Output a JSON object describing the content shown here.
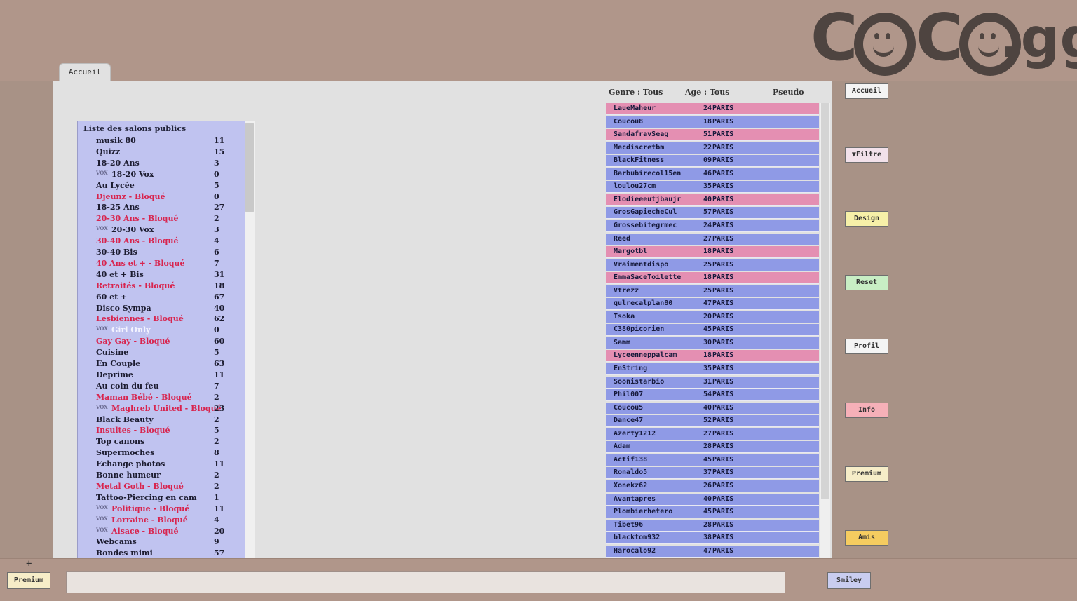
{
  "brand": {
    "logo_text": "COCO.gg"
  },
  "tabs": [
    {
      "label": "Accueil"
    }
  ],
  "rooms": {
    "title": "Liste des salons publics",
    "items": [
      {
        "name": "musik 80",
        "count": "11",
        "state": "normal",
        "vox": false
      },
      {
        "name": "Quizz",
        "count": "15",
        "state": "normal",
        "vox": false
      },
      {
        "name": "18-20 Ans",
        "count": "3",
        "state": "normal",
        "vox": false
      },
      {
        "name": "18-20 Vox",
        "count": "0",
        "state": "normal",
        "vox": true
      },
      {
        "name": "Au Lycée",
        "count": "5",
        "state": "normal",
        "vox": false
      },
      {
        "name": "Djeunz - Bloqué",
        "count": "0",
        "state": "blocked",
        "vox": false
      },
      {
        "name": "18-25 Ans",
        "count": "27",
        "state": "normal",
        "vox": false
      },
      {
        "name": "20-30 Ans - Bloqué",
        "count": "2",
        "state": "blocked",
        "vox": false
      },
      {
        "name": "20-30 Vox",
        "count": "3",
        "state": "normal",
        "vox": true
      },
      {
        "name": "30-40 Ans - Bloqué",
        "count": "4",
        "state": "blocked",
        "vox": false
      },
      {
        "name": "30-40 Bis",
        "count": "6",
        "state": "normal",
        "vox": false
      },
      {
        "name": "40 Ans et + - Bloqué",
        "count": "7",
        "state": "blocked",
        "vox": false
      },
      {
        "name": "40 et + Bis",
        "count": "31",
        "state": "normal",
        "vox": false
      },
      {
        "name": "Retraités - Bloqué",
        "count": "18",
        "state": "blocked",
        "vox": false
      },
      {
        "name": "60 et +",
        "count": "67",
        "state": "normal",
        "vox": false
      },
      {
        "name": "Disco Sympa",
        "count": "40",
        "state": "normal",
        "vox": false
      },
      {
        "name": "Lesbiennes - Bloqué",
        "count": "62",
        "state": "blocked",
        "vox": false
      },
      {
        "name": "Girl Only",
        "count": "0",
        "state": "light",
        "vox": true
      },
      {
        "name": "Gay Gay - Bloqué",
        "count": "60",
        "state": "blocked",
        "vox": false
      },
      {
        "name": "Cuisine",
        "count": "5",
        "state": "normal",
        "vox": false
      },
      {
        "name": "En Couple",
        "count": "63",
        "state": "normal",
        "vox": false
      },
      {
        "name": "Deprime",
        "count": "11",
        "state": "normal",
        "vox": false
      },
      {
        "name": "Au coin du feu",
        "count": "7",
        "state": "normal",
        "vox": false
      },
      {
        "name": "Maman Bébé - Bloqué",
        "count": "2",
        "state": "blocked",
        "vox": false
      },
      {
        "name": "Maghreb United - Bloqué",
        "count": "23",
        "state": "blocked",
        "vox": true
      },
      {
        "name": "Black Beauty",
        "count": "2",
        "state": "normal",
        "vox": false
      },
      {
        "name": "Insultes - Bloqué",
        "count": "5",
        "state": "blocked",
        "vox": false
      },
      {
        "name": "Top canons",
        "count": "2",
        "state": "normal",
        "vox": false
      },
      {
        "name": "Supermoches",
        "count": "8",
        "state": "normal",
        "vox": false
      },
      {
        "name": "Echange photos",
        "count": "11",
        "state": "normal",
        "vox": false
      },
      {
        "name": "Bonne humeur",
        "count": "2",
        "state": "normal",
        "vox": false
      },
      {
        "name": "Metal Goth - Bloqué",
        "count": "2",
        "state": "blocked",
        "vox": false
      },
      {
        "name": "Tattoo-Piercing en cam",
        "count": "1",
        "state": "normal",
        "vox": false
      },
      {
        "name": "Politique - Bloqué",
        "count": "11",
        "state": "blocked",
        "vox": true
      },
      {
        "name": "Lorraine - Bloqué",
        "count": "4",
        "state": "blocked",
        "vox": true
      },
      {
        "name": "Alsace - Bloqué",
        "count": "20",
        "state": "blocked",
        "vox": true
      },
      {
        "name": "Webcams",
        "count": "9",
        "state": "normal",
        "vox": false
      },
      {
        "name": "Rondes mimi",
        "count": "57",
        "state": "normal",
        "vox": false
      }
    ],
    "vox_tag": "VOX"
  },
  "filters": {
    "genre": "Genre : Tous",
    "age": "Age : Tous",
    "pseudo": "Pseudo"
  },
  "users": [
    {
      "name": "LaueMaheur",
      "age": "24",
      "city": "PARIS",
      "g": "f"
    },
    {
      "name": "Coucou8",
      "age": "18",
      "city": "PARIS",
      "g": "m"
    },
    {
      "name": "SandafravSeag",
      "age": "51",
      "city": "PARIS",
      "g": "f"
    },
    {
      "name": "Mecdiscretbm",
      "age": "22",
      "city": "PARIS",
      "g": "m"
    },
    {
      "name": "BlackFitness",
      "age": "09",
      "city": "PARIS",
      "g": "m"
    },
    {
      "name": "Barbubirecol15en",
      "age": "46",
      "city": "PARIS",
      "g": "m"
    },
    {
      "name": "loulou27cm",
      "age": "35",
      "city": "PARIS",
      "g": "m"
    },
    {
      "name": "Elodieeeutjbaujr",
      "age": "40",
      "city": "PARIS",
      "g": "f"
    },
    {
      "name": "GrosGapiecheCul",
      "age": "57",
      "city": "PARIS",
      "g": "m"
    },
    {
      "name": "Grossebitegrmec",
      "age": "24",
      "city": "PARIS",
      "g": "m"
    },
    {
      "name": "Reed",
      "age": "27",
      "city": "PARIS",
      "g": "m"
    },
    {
      "name": "Margotbl",
      "age": "18",
      "city": "PARIS",
      "g": "f"
    },
    {
      "name": "Vraimentdispo",
      "age": "25",
      "city": "PARIS",
      "g": "m"
    },
    {
      "name": "EmmaSaceToilette",
      "age": "18",
      "city": "PARIS",
      "g": "f"
    },
    {
      "name": "Vtrezz",
      "age": "25",
      "city": "PARIS",
      "g": "m"
    },
    {
      "name": "qulrecalplan80",
      "age": "47",
      "city": "PARIS",
      "g": "m"
    },
    {
      "name": "Tsoka",
      "age": "20",
      "city": "PARIS",
      "g": "m"
    },
    {
      "name": "C380picorien",
      "age": "45",
      "city": "PARIS",
      "g": "m"
    },
    {
      "name": "Samm",
      "age": "30",
      "city": "PARIS",
      "g": "m"
    },
    {
      "name": "Lyceenneppalcam",
      "age": "18",
      "city": "PARIS",
      "g": "f"
    },
    {
      "name": "EnString",
      "age": "35",
      "city": "PARIS",
      "g": "m"
    },
    {
      "name": "Soonistarbio",
      "age": "31",
      "city": "PARIS",
      "g": "m"
    },
    {
      "name": "Phil007",
      "age": "54",
      "city": "PARIS",
      "g": "m"
    },
    {
      "name": "Coucou5",
      "age": "40",
      "city": "PARIS",
      "g": "m"
    },
    {
      "name": "Dance47",
      "age": "52",
      "city": "PARIS",
      "g": "m"
    },
    {
      "name": "Azerty1212",
      "age": "27",
      "city": "PARIS",
      "g": "m"
    },
    {
      "name": "Adam",
      "age": "28",
      "city": "PARIS",
      "g": "m"
    },
    {
      "name": "Actif138",
      "age": "45",
      "city": "PARIS",
      "g": "m"
    },
    {
      "name": "Ronaldo5",
      "age": "37",
      "city": "PARIS",
      "g": "m"
    },
    {
      "name": "Xonekz62",
      "age": "26",
      "city": "PARIS",
      "g": "m"
    },
    {
      "name": "Avantapres",
      "age": "40",
      "city": "PARIS",
      "g": "m"
    },
    {
      "name": "Plombierhetero",
      "age": "45",
      "city": "PARIS",
      "g": "m"
    },
    {
      "name": "Tibet96",
      "age": "28",
      "city": "PARIS",
      "g": "m"
    },
    {
      "name": "blacktom932",
      "age": "38",
      "city": "PARIS",
      "g": "m"
    },
    {
      "name": "Harocalo92",
      "age": "47",
      "city": "PARIS",
      "g": "m"
    }
  ],
  "right_buttons": [
    {
      "label": "Accueil",
      "color": "#f4f4f4"
    },
    {
      "label": "▼Filtre",
      "color": "#f2e1ea"
    },
    {
      "label": "Design",
      "color": "#f6f0a8"
    },
    {
      "label": "Reset",
      "color": "#c8eec4"
    },
    {
      "label": "Profil",
      "color": "#f4f4f4"
    },
    {
      "label": "Info",
      "color": "#f6b0b8"
    },
    {
      "label": "Premium",
      "color": "#f6edc8"
    },
    {
      "label": "Amis",
      "color": "#f5cc60"
    }
  ],
  "bottom": {
    "plus": "+",
    "premium": "Premium",
    "smiley": "Smiley",
    "premium_color": "#f6edc8",
    "smiley_color": "#c9cdf0"
  }
}
